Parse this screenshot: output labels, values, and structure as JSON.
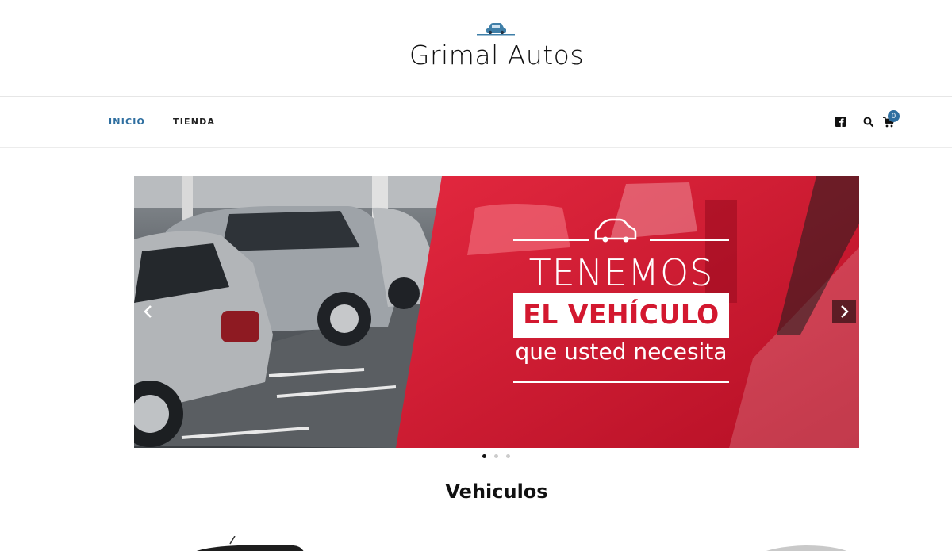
{
  "site": {
    "title": "Grimal Autos",
    "logo_icon": "car-icon"
  },
  "nav": {
    "items": [
      {
        "label": "INICIO",
        "active": true
      },
      {
        "label": "TIENDA",
        "active": false
      }
    ],
    "icons": [
      "facebook-icon",
      "search-icon",
      "cart-icon"
    ],
    "cart_count": "0",
    "active_color": "#2f6fa0"
  },
  "slider": {
    "headline": "TENEMOS",
    "highlight": "EL VEHÍCULO",
    "subline": "que usted necesita",
    "accent_color": "#d3182f",
    "prev_icon": "chevron-left-icon",
    "next_icon": "chevron-right-icon",
    "dots": 3,
    "active_dot": 1
  },
  "section": {
    "title": "Vehiculos"
  }
}
